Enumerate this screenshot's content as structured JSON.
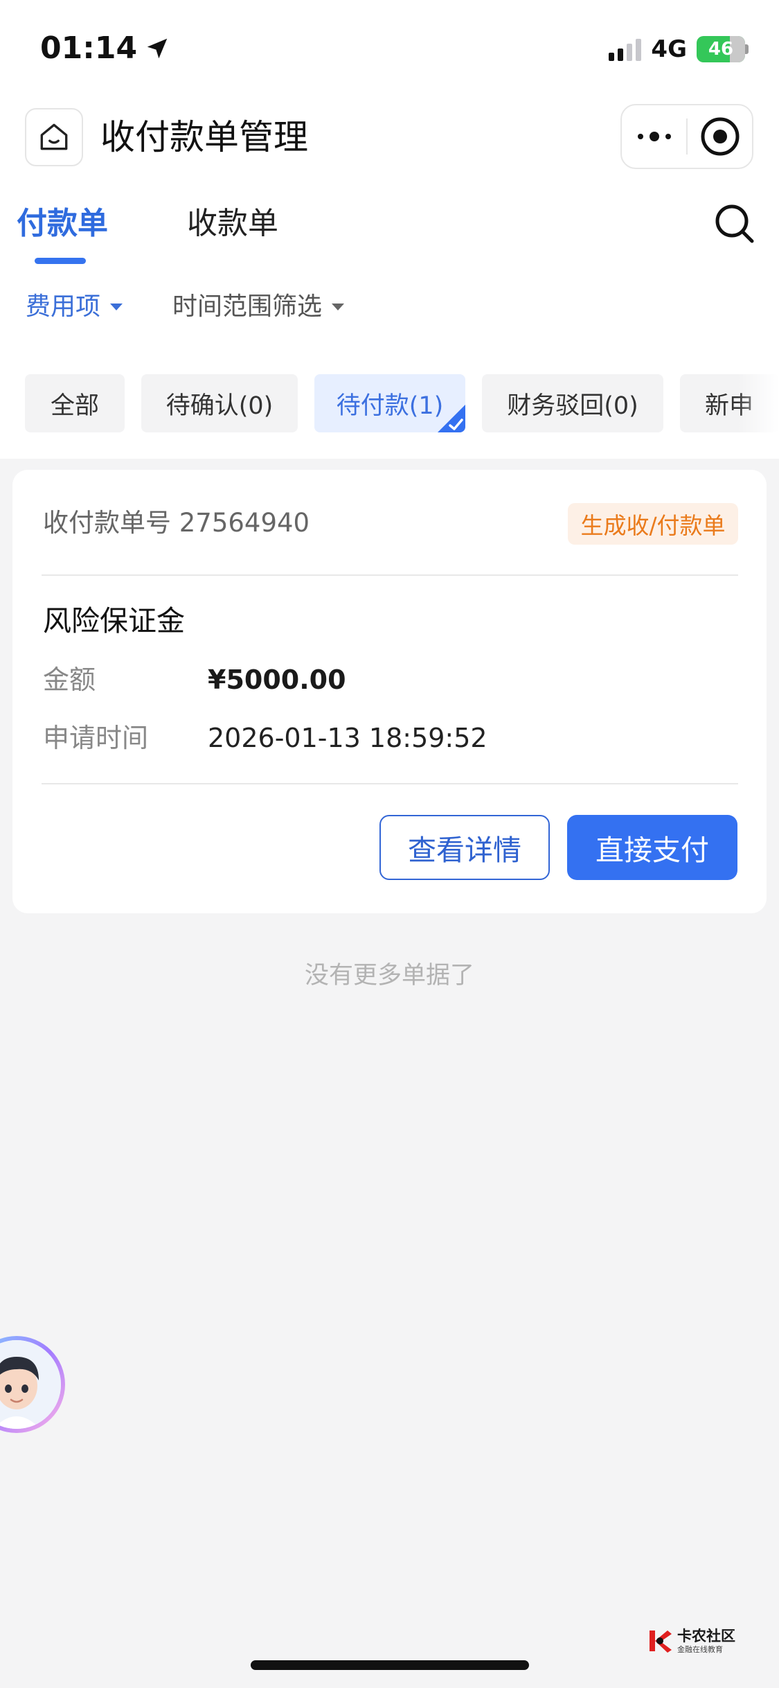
{
  "status_bar": {
    "time": "01:14",
    "network": "4G",
    "battery": "46"
  },
  "header": {
    "title": "收付款单管理"
  },
  "tabs": [
    {
      "label": "付款单",
      "active": true
    },
    {
      "label": "收款单",
      "active": false
    }
  ],
  "filters": {
    "fee_item": "费用项",
    "time_range": "时间范围筛选"
  },
  "status_chips": [
    {
      "label": "全部",
      "active": false
    },
    {
      "label": "待确认(0)",
      "active": false
    },
    {
      "label": "待付款(1)",
      "active": true
    },
    {
      "label": "财务驳回(0)",
      "active": false
    },
    {
      "label": "新申",
      "active": false
    }
  ],
  "order": {
    "number_label": "收付款单号",
    "number": "27564940",
    "number_display": "收付款单号 27564940",
    "badge": "生成收/付款单",
    "item_name": "风险保证金",
    "amount_label": "金额",
    "amount": "¥5000.00",
    "time_label": "申请时间",
    "time": "2026-01-13 18:59:52",
    "detail_button": "查看详情",
    "pay_button": "直接支付"
  },
  "list_end_text": "没有更多单据了",
  "watermark": {
    "main": "卡农社区",
    "sub": "金融在线教育"
  },
  "colors": {
    "accent": "#3471f1",
    "badge_text": "#ea7b1c",
    "badge_bg": "#fdf0e6",
    "background": "#f4f4f5"
  }
}
